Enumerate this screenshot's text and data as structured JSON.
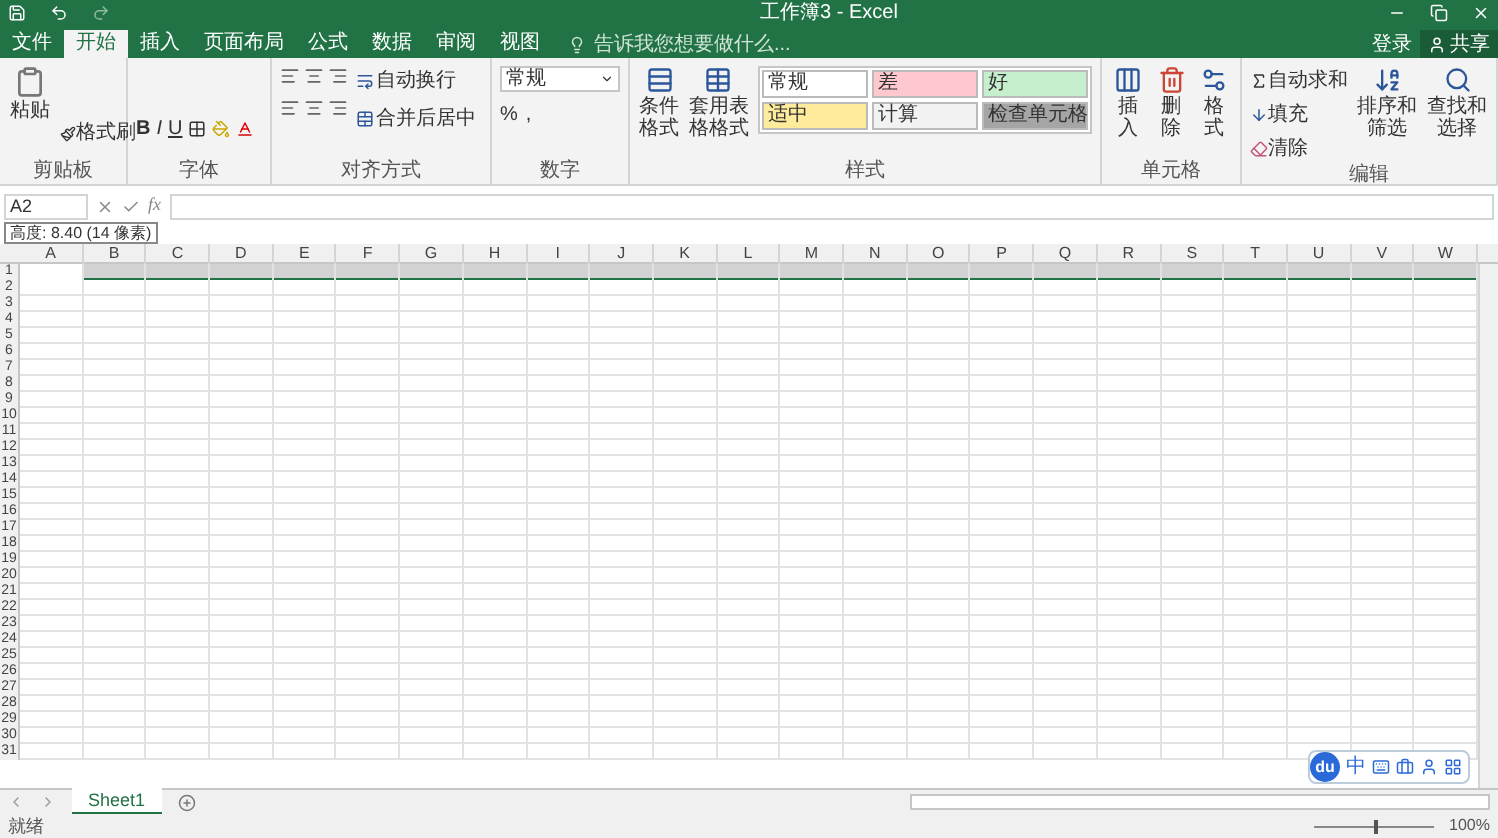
{
  "title_bar": {
    "title": "工作簿3 - Excel"
  },
  "menu_tabs": [
    {
      "label": "文件",
      "selected": false
    },
    {
      "label": "开始",
      "selected": true
    },
    {
      "label": "插入",
      "selected": false
    },
    {
      "label": "页面布局",
      "selected": false
    },
    {
      "label": "公式",
      "selected": false
    },
    {
      "label": "数据",
      "selected": false
    },
    {
      "label": "审阅",
      "selected": false
    },
    {
      "label": "视图",
      "selected": false
    }
  ],
  "tell_me": {
    "placeholder": "告诉我您想要做什么..."
  },
  "account": {
    "sign_in": "登录",
    "share": "共享"
  },
  "clipboard": {
    "label": "剪贴板",
    "paste": "粘贴",
    "format_painter": "格式刷"
  },
  "font": {
    "label": "字体",
    "bold": "B",
    "italic": "I",
    "underline": "U"
  },
  "alignment": {
    "label": "对齐方式",
    "wrap": "自动换行",
    "merge": "合并后居中"
  },
  "number": {
    "label": "数字",
    "format": "常规",
    "percent": "%",
    "comma": ","
  },
  "styles": {
    "label": "样式",
    "conditional": "条件格式",
    "table": "套用表格格式",
    "cells": [
      {
        "label": "常规",
        "color": "#ffffff"
      },
      {
        "label": "差",
        "color": "#ffc7ce"
      },
      {
        "label": "好",
        "color": "#c6efce"
      },
      {
        "label": "适中",
        "color": "#ffeb9c"
      },
      {
        "label": "计算",
        "color": "#f2f2f2"
      },
      {
        "label": "检查单元格",
        "color": "#a5a5a5"
      }
    ]
  },
  "cells_group": {
    "label": "单元格",
    "insert": "插入",
    "delete": "删除",
    "format": "格式"
  },
  "editing": {
    "label": "编辑",
    "autosum": "自动求和",
    "fill": "填充",
    "clear": "清除",
    "sort": "排序和筛选",
    "find": "查找和选择"
  },
  "formula_bar": {
    "name_box": "A2",
    "fx": "fx"
  },
  "tooltip": "高度: 8.40 (14 像素)",
  "columns": [
    "A",
    "B",
    "C",
    "D",
    "E",
    "F",
    "G",
    "H",
    "I",
    "J",
    "K",
    "L",
    "M",
    "N",
    "O",
    "P",
    "Q",
    "R",
    "S",
    "T",
    "U",
    "V",
    "W"
  ],
  "rows": [
    {
      "label": "1",
      "selected": true
    },
    {
      "label": "2",
      "selected": false
    },
    {
      "label": "3",
      "selected": false
    },
    {
      "label": "4",
      "selected": false
    },
    {
      "label": "5",
      "selected": false
    },
    {
      "label": "6",
      "selected": false
    },
    {
      "label": "7",
      "selected": false
    },
    {
      "label": "8",
      "selected": false
    },
    {
      "label": "9",
      "selected": false
    },
    {
      "label": "10",
      "selected": false
    },
    {
      "label": "11",
      "selected": false
    },
    {
      "label": "12",
      "selected": false
    },
    {
      "label": "13",
      "selected": false
    },
    {
      "label": "14",
      "selected": false
    },
    {
      "label": "15",
      "selected": false
    },
    {
      "label": "16",
      "selected": false
    },
    {
      "label": "17",
      "selected": false
    },
    {
      "label": "18",
      "selected": false
    },
    {
      "label": "19",
      "selected": false
    },
    {
      "label": "20",
      "selected": false
    },
    {
      "label": "21",
      "selected": false
    },
    {
      "label": "22",
      "selected": false
    },
    {
      "label": "23",
      "selected": false
    },
    {
      "label": "24",
      "selected": false
    },
    {
      "label": "25",
      "selected": false
    },
    {
      "label": "26",
      "selected": false
    },
    {
      "label": "27",
      "selected": false
    },
    {
      "label": "28",
      "selected": false
    },
    {
      "label": "29",
      "selected": false
    },
    {
      "label": "30",
      "selected": false
    },
    {
      "label": "31",
      "selected": false
    }
  ],
  "sheet_tabs": [
    {
      "label": "Sheet1",
      "selected": true
    }
  ],
  "ime_toolbar": {
    "logo": "du",
    "mode": "中"
  },
  "status_bar": {
    "status": "就绪",
    "zoom": "100%",
    "zoom_slider": {
      "level": 0.5
    }
  }
}
